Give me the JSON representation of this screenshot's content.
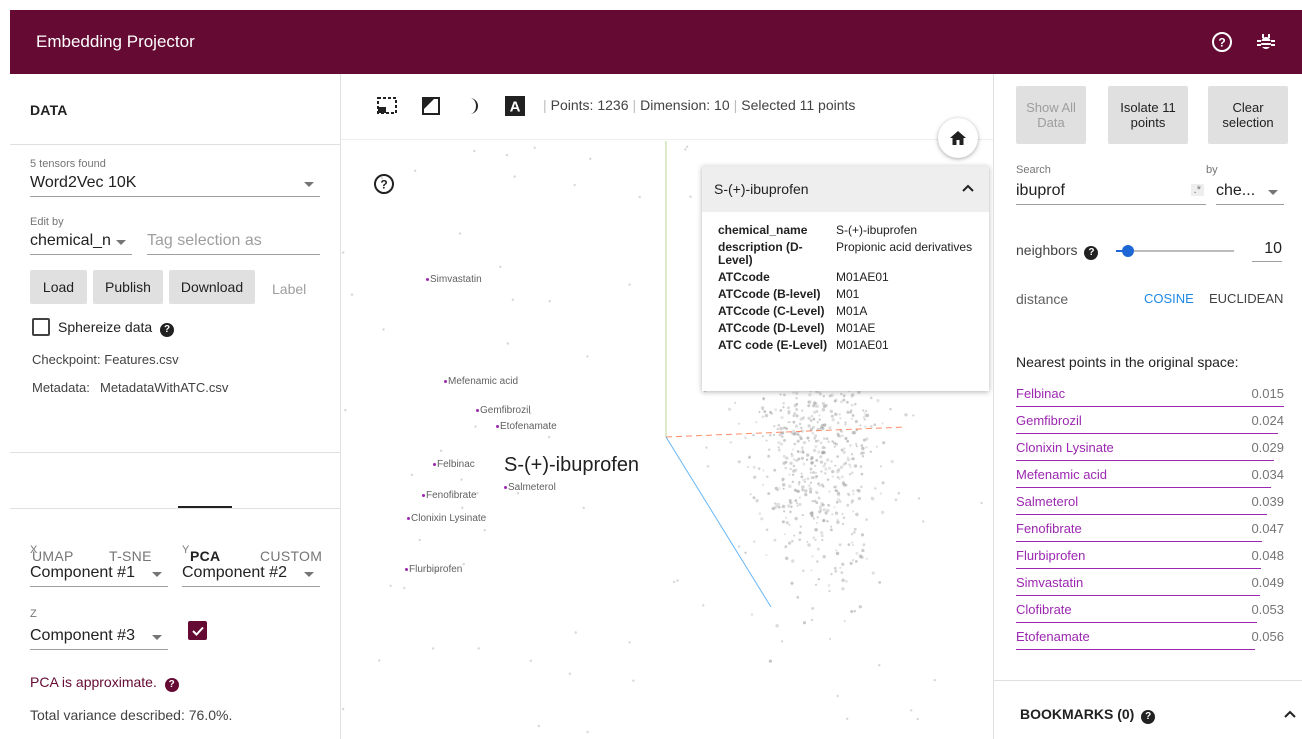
{
  "header": {
    "title": "Embedding Projector"
  },
  "data_panel": {
    "title": "DATA",
    "tensors_found": "5 tensors found",
    "tensor_selected": "Word2Vec 10K",
    "edit_by_label": "Edit by",
    "edit_by_value": "chemical_n",
    "tag_placeholder": "Tag selection as",
    "buttons": {
      "load": "Load",
      "publish": "Publish",
      "download": "Download",
      "label": "Label"
    },
    "sphereize_label": "Sphereize data",
    "checkpoint": "Checkpoint: Features.csv",
    "metadata_label": "Metadata:",
    "metadata_value": "MetadataWithATC.csv"
  },
  "projection_tabs": [
    "UMAP",
    "T-SNE",
    "PCA",
    "CUSTOM"
  ],
  "active_tab": "PCA",
  "pca": {
    "x_label": "X",
    "x_value": "Component #1",
    "y_label": "Y",
    "y_value": "Component #2",
    "z_label": "Z",
    "z_value": "Component #3",
    "z_enabled": true,
    "approx_text": "PCA is approximate.",
    "variance_text": "Total variance described: 76.0%."
  },
  "toolbar": {
    "points": "Points: 1236",
    "dimension": "Dimension: 10",
    "selected": "Selected 11 points"
  },
  "scatter": {
    "big_label": "S-(+)-ibuprofen",
    "labels": [
      "Simvastatin",
      "Mefenamic acid",
      "Gemfibrozil",
      "Etofenamate",
      "Felbinac",
      "Salmeterol",
      "Fenofibrate",
      "Clonixin Lysinate",
      "Flurbiprofen"
    ]
  },
  "info_card": {
    "title": "S-(+)-ibuprofen",
    "rows": [
      {
        "key": "chemical_name",
        "value": "S-(+)-ibuprofen"
      },
      {
        "key": "description (D-Level)",
        "value": "Propionic acid derivatives"
      },
      {
        "key": "ATCcode",
        "value": "M01AE01"
      },
      {
        "key": "ATCcode (B-level)",
        "value": "M01"
      },
      {
        "key": "ATCcode (C-Level)",
        "value": "M01A"
      },
      {
        "key": "ATCcode (D-Level)",
        "value": "M01AE"
      },
      {
        "key": "ATC code (E-Level)",
        "value": "M01AE01"
      }
    ]
  },
  "right_panel": {
    "show_all": "Show All Data",
    "isolate": "Isolate 11 points",
    "clear": "Clear selection",
    "search_label": "Search",
    "search_value": "ibuprof",
    "regex_icon": ".*",
    "by_label": "by",
    "by_value": "che...",
    "neighbors_label": "neighbors",
    "neighbors_value": "10",
    "neighbors_fraction": 0.1,
    "distance_label": "distance",
    "distance_cosine": "COSINE",
    "distance_euclidean": "EUCLIDEAN",
    "nearest_title": "Nearest points in the original space:",
    "nearest": [
      {
        "name": "Felbinac",
        "value": "0.015"
      },
      {
        "name": "Gemfibrozil",
        "value": "0.024"
      },
      {
        "name": "Clonixin Lysinate",
        "value": "0.029"
      },
      {
        "name": "Mefenamic acid",
        "value": "0.034"
      },
      {
        "name": "Salmeterol",
        "value": "0.039"
      },
      {
        "name": "Fenofibrate",
        "value": "0.047"
      },
      {
        "name": "Flurbiprofen",
        "value": "0.048"
      },
      {
        "name": "Simvastatin",
        "value": "0.049"
      },
      {
        "name": "Clofibrate",
        "value": "0.053"
      },
      {
        "name": "Etofenamate",
        "value": "0.056"
      }
    ],
    "bookmarks": "BOOKMARKS (0)"
  },
  "colors": {
    "brand": "#650a33",
    "accent_purple": "#9c27b0",
    "cosine_blue": "#1e88e5"
  }
}
